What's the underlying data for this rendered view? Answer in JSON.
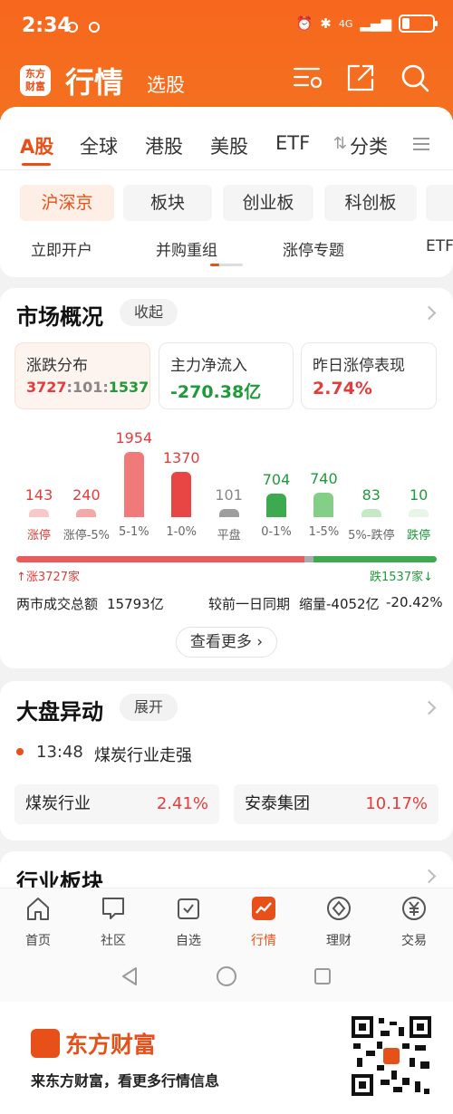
{
  "status_bar": {
    "time": "2:34",
    "network": "4G"
  },
  "header": {
    "logo_line1": "东方",
    "logo_line2": "财富",
    "title": "行情",
    "subtitle": "选股"
  },
  "tabs": [
    {
      "label": "A股",
      "active": true
    },
    {
      "label": "全球"
    },
    {
      "label": "港股"
    },
    {
      "label": "美股"
    },
    {
      "label": "ETF"
    },
    {
      "label": "分类"
    }
  ],
  "chips": [
    {
      "label": "沪深京",
      "active": true
    },
    {
      "label": "板块"
    },
    {
      "label": "创业板"
    },
    {
      "label": "科创板"
    }
  ],
  "links": [
    "立即开户",
    "并购重组",
    "涨停专题",
    "ETF"
  ],
  "market": {
    "title": "市场概况",
    "collapse_label": "收起",
    "boxes": [
      {
        "label": "涨跌分布",
        "value_up": "3727",
        "sep1": ":",
        "value_flat": "101",
        "sep2": ":",
        "value_down": "1537"
      },
      {
        "label": "主力净流入",
        "value": "-270.38亿"
      },
      {
        "label": "昨日涨停表现",
        "value": "2.74%"
      }
    ],
    "up_text": "涨3727家",
    "down_text": "跌1537家",
    "turnover_label": "两市成交总额",
    "turnover_value": "15793亿",
    "compare_label": "较前一日同期",
    "compare_change": "缩量-4052亿",
    "compare_pct": "-20.42%",
    "more_label": "查看更多"
  },
  "chart_data": {
    "type": "bar",
    "categories": [
      "涨停",
      "涨停-5%",
      "5-1%",
      "1-0%",
      "平盘",
      "0-1%",
      "1-5%",
      "5%-跌停",
      "跌停"
    ],
    "values": [
      143,
      240,
      1954,
      1370,
      101,
      704,
      740,
      83,
      10
    ],
    "colors": [
      "#f7c9c9",
      "#f4a9a9",
      "#f07a7a",
      "#e84545",
      "#9e9e9e",
      "#3daa4f",
      "#84cf87",
      "#c6e9c5",
      "#e8f6e8"
    ],
    "label_colors": [
      "#e33c3c",
      "#e33c3c",
      "#e33c3c",
      "#e33c3c",
      "#888888",
      "#1f9a3a",
      "#1f9a3a",
      "#1f9a3a",
      "#1f9a3a"
    ],
    "ylim": [
      0,
      1954
    ]
  },
  "dapan": {
    "title": "大盘异动",
    "expand_label": "展开",
    "time": "13:48",
    "event": "煤炭行业走强",
    "item1_name": "煤炭行业",
    "item1_pct": "2.41%",
    "item2_name": "安泰集团",
    "item2_pct": "10.17%"
  },
  "industry": {
    "title": "行业板块"
  },
  "bottom_nav": [
    {
      "label": "首页"
    },
    {
      "label": "社区"
    },
    {
      "label": "自选"
    },
    {
      "label": "行情",
      "active": true
    },
    {
      "label": "理财"
    },
    {
      "label": "交易"
    }
  ],
  "banner": {
    "brand": "东方财富",
    "slogan": "来东方财富，看更多行情信息"
  },
  "colors": {
    "brand": "#e8501a",
    "up": "#e33c3c",
    "down": "#1f9a3a"
  }
}
